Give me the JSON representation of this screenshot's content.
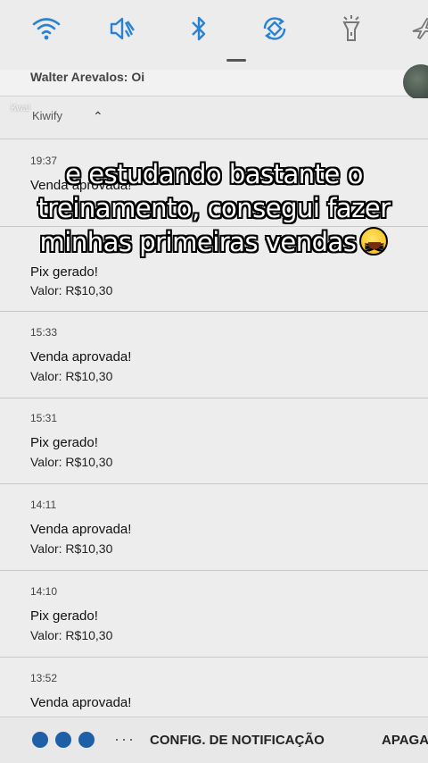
{
  "quick_settings": {
    "icons": [
      "wifi-icon",
      "vibrate-icon",
      "bluetooth-icon",
      "auto-rotate-icon",
      "flashlight-icon",
      "airplane-icon"
    ],
    "accent_color": "#2a82d0"
  },
  "chat": {
    "text": "Walter Arevalos:  Oi"
  },
  "group": {
    "app_name": "Kiwify",
    "watermark": "Kwai"
  },
  "notifications": [
    {
      "time": "19:37",
      "title": "Venda aprovada!",
      "value": ""
    },
    {
      "time": "",
      "title": "Pix gerado!",
      "value": "Valor: R$10,30"
    },
    {
      "time": "15:33",
      "title": "Venda aprovada!",
      "value": "Valor: R$10,30"
    },
    {
      "time": "15:31",
      "title": "Pix gerado!",
      "value": "Valor: R$10,30"
    },
    {
      "time": "14:11",
      "title": "Venda aprovada!",
      "value": "Valor: R$10,30"
    },
    {
      "time": "14:10",
      "title": "Pix gerado!",
      "value": "Valor: R$10,30"
    },
    {
      "time": "13:52",
      "title": "Venda aprovada!",
      "value": ""
    }
  ],
  "caption": {
    "line1": "e estudando bastante o",
    "line2": "treinamento, consegui fazer",
    "line3": "minhas primeiras vendas"
  },
  "bottom_bar": {
    "dots": "···",
    "config_label": "CONFIG. DE NOTIFICAÇÃO",
    "clear_label": "APAGAR"
  }
}
